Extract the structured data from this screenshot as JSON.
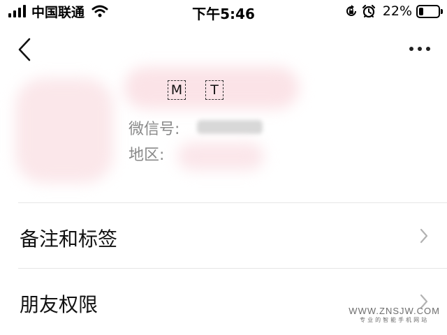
{
  "status_bar": {
    "carrier": "中国联通",
    "time": "下午5:46",
    "battery_percent": "22%",
    "battery_level": 0.22
  },
  "nav": {
    "back_icon": "chevron-left-icon",
    "more_icon": "more-horizontal-icon"
  },
  "profile": {
    "name_initials": [
      "M",
      "T"
    ],
    "wechat_id_label": "微信号:",
    "region_label": "地区:"
  },
  "menu": [
    {
      "label": "备注和标签"
    },
    {
      "label": "朋友权限"
    }
  ],
  "watermark": {
    "site": "WWW.ZNSJW.COM",
    "tagline": "专业的智能手机网站"
  },
  "colors": {
    "text": "#111111",
    "label_gray": "#8a8a8a",
    "divider": "#e6e6e6",
    "chevron": "#b2b2b2"
  }
}
